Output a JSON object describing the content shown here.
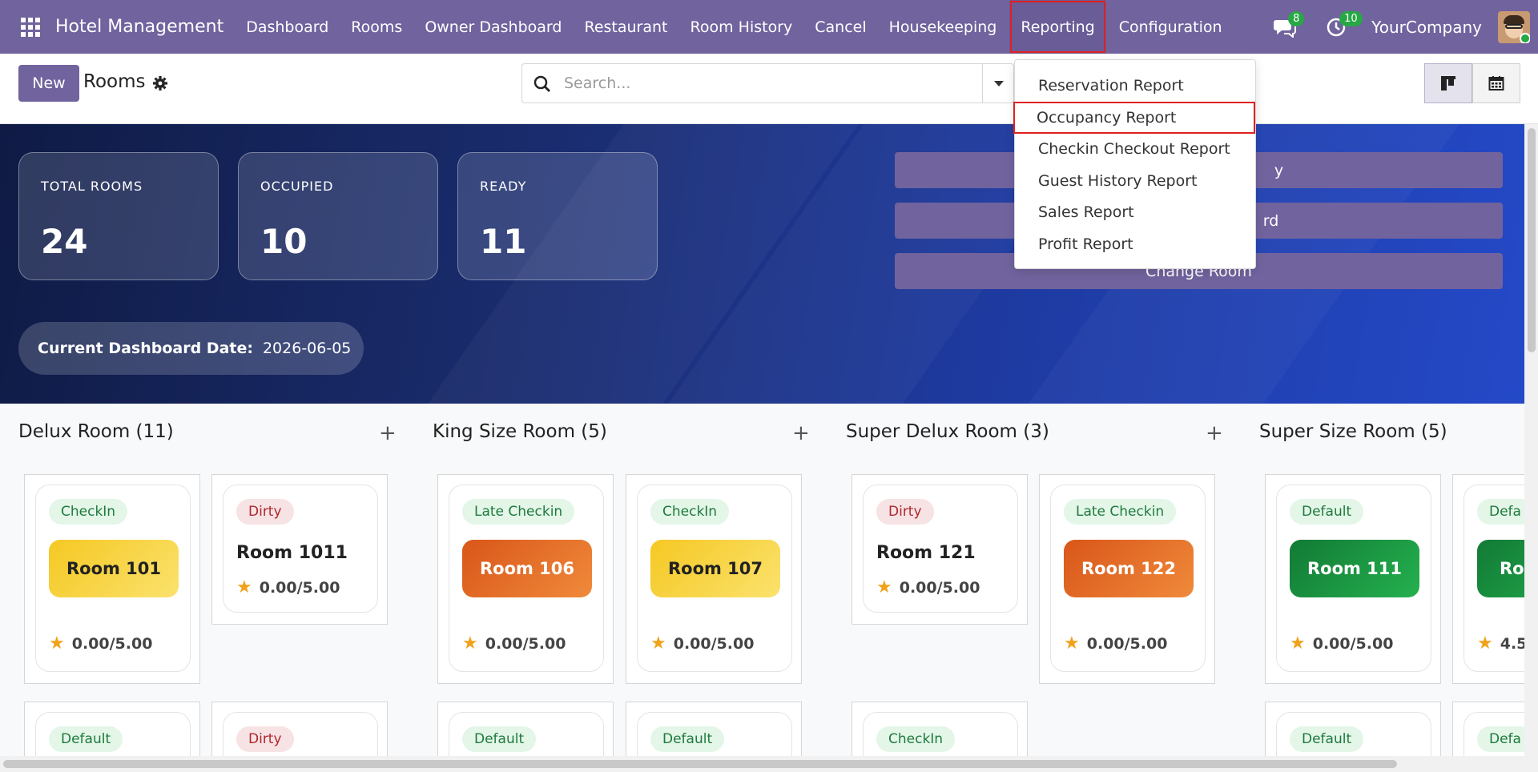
{
  "navbar": {
    "apps_icon": "apps-grid-icon",
    "brand": "Hotel Management",
    "menu": [
      "Dashboard",
      "Rooms",
      "Owner Dashboard",
      "Restaurant",
      "Room History",
      "Cancel",
      "Housekeeping",
      "Reporting",
      "Configuration"
    ],
    "messages_count": "8",
    "activities_count": "10",
    "company": "YourCompany"
  },
  "control": {
    "new_label": "New",
    "title": "Rooms",
    "search_placeholder": "Search..."
  },
  "hero": {
    "stats": [
      {
        "label": "TOTAL ROOMS",
        "value": "24"
      },
      {
        "label": "OCCUPIED",
        "value": "10"
      },
      {
        "label": "READY",
        "value": "11"
      }
    ],
    "date_label": "Current Dashboard Date:",
    "date_value": "2026-06-05",
    "actions": [
      "y",
      "rd",
      "Change Room"
    ]
  },
  "reporting_dropdown": {
    "items": [
      "Reservation Report",
      "Occupancy Report",
      "Checkin Checkout Report",
      "Guest History Report",
      "Sales Report",
      "Profit Report"
    ]
  },
  "kanban": {
    "columns": [
      {
        "title": "Delux Room (11)"
      },
      {
        "title": "King Size Room (5)"
      },
      {
        "title": "Super Delux Room (3)"
      },
      {
        "title": "Super Size Room (5)"
      }
    ],
    "cards": [
      {
        "tag": "CheckIn",
        "room": "Room 101",
        "rating": "0.00/5.00"
      },
      {
        "tag": "Dirty",
        "room": "Room 1011",
        "rating": "0.00/5.00"
      },
      {
        "tag": "Late Checkin",
        "room": "Room 106",
        "rating": "0.00/5.00"
      },
      {
        "tag": "CheckIn",
        "room": "Room 107",
        "rating": "0.00/5.00"
      },
      {
        "tag": "Dirty",
        "room": "Room 121",
        "rating": "0.00/5.00"
      },
      {
        "tag": "Late Checkin",
        "room": "Room 122",
        "rating": "0.00/5.00"
      },
      {
        "tag": "Default",
        "room": "Room 111",
        "rating": "0.00/5.00"
      },
      {
        "tag": "Defa",
        "room": "Ro",
        "rating": "4.5"
      }
    ],
    "row2_tags": [
      "Default",
      "Dirty",
      "Default",
      "Default",
      "CheckIn",
      "Default",
      "Defa"
    ]
  },
  "colors": {
    "brand": "#71639e",
    "highlight_outline": "#e02020",
    "badge_green": "#28a745",
    "yellow_room": "#f5c823",
    "orange_room": "#e0621f",
    "green_room": "#1a9640"
  }
}
